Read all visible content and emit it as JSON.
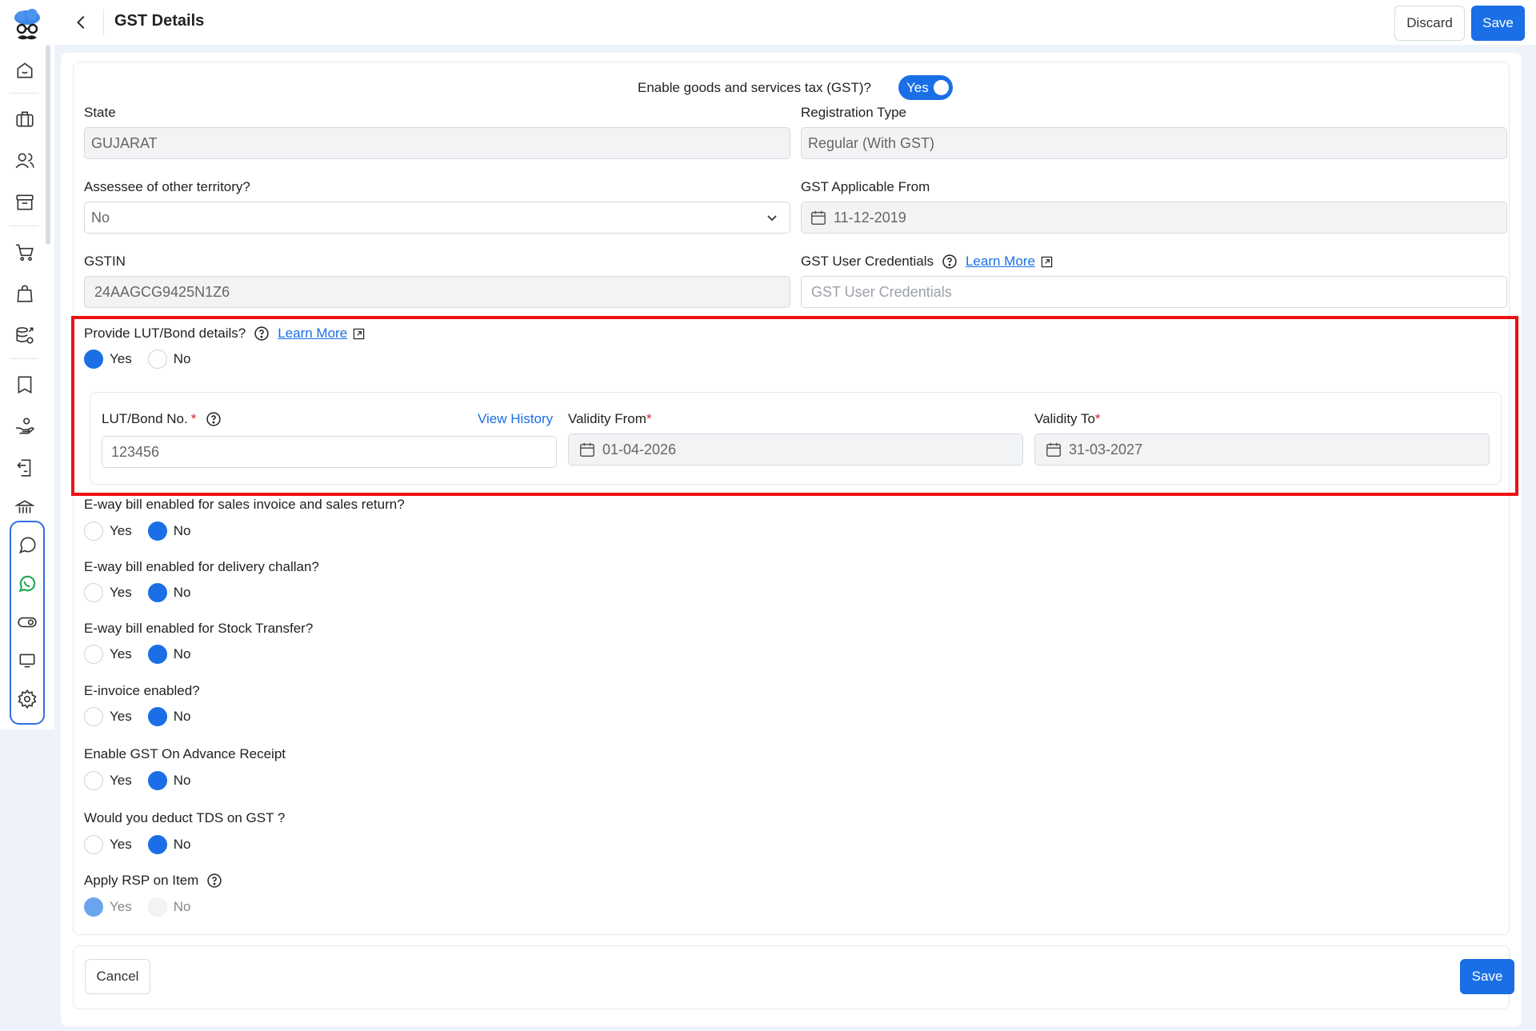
{
  "header": {
    "title": "GST Details",
    "discard_label": "Discard",
    "save_label": "Save"
  },
  "form": {
    "enable_gst": {
      "question": "Enable goods and services tax (GST)?",
      "toggle_label": "Yes"
    },
    "state": {
      "label": "State",
      "value": "GUJARAT"
    },
    "registration_type": {
      "label": "Registration Type",
      "value": "Regular (With GST)"
    },
    "assessee": {
      "label": "Assessee of other territory?",
      "value": "No"
    },
    "gst_applicable_from": {
      "label": "GST Applicable From",
      "value": "11-12-2019"
    },
    "gstin": {
      "label": "GSTIN",
      "value": "24AAGCG9425N1Z6"
    },
    "gst_user_credentials": {
      "label": "GST User Credentials",
      "learn_more": "Learn More",
      "placeholder": "GST User Credentials"
    },
    "lut": {
      "question": "Provide LUT/Bond details?",
      "learn_more": "Learn More",
      "yes": "Yes",
      "no": "No",
      "bond_no_label": "LUT/Bond No.",
      "required_mark": "*",
      "view_history": "View History",
      "bond_no_value": "123456",
      "validity_from_label": "Validity From",
      "validity_from_value": "01-04-2026",
      "validity_to_label": "Validity To",
      "validity_to_value": "31-03-2027"
    },
    "questions": [
      {
        "label": "E-way bill enabled for sales invoice and sales return?",
        "yes": "Yes",
        "no": "No"
      },
      {
        "label": "E-way bill enabled for delivery challan?",
        "yes": "Yes",
        "no": "No"
      },
      {
        "label": "E-way bill enabled for Stock Transfer?",
        "yes": "Yes",
        "no": "No"
      },
      {
        "label": "E-invoice enabled?",
        "yes": "Yes",
        "no": "No"
      },
      {
        "label": "Enable GST On Advance Receipt",
        "yes": "Yes",
        "no": "No"
      },
      {
        "label": "Would you deduct TDS on GST ?",
        "yes": "Yes",
        "no": "No"
      },
      {
        "label": "Apply RSP on Item",
        "yes": "Yes",
        "no": "No"
      }
    ]
  },
  "footer": {
    "cancel_label": "Cancel",
    "save_label": "Save"
  },
  "colors": {
    "primary": "#1a6fe6",
    "highlight": "#ee1111",
    "whatsapp": "#1fa855"
  },
  "sidebar_icons": [
    "home-icon",
    "briefcase-icon",
    "users-icon",
    "archive-icon",
    "cart-icon",
    "bag-icon",
    "database-export-icon",
    "book-icon",
    "hand-coins-icon",
    "receipt-icon",
    "bank-icon",
    "chat-icon",
    "whatsapp-icon",
    "toggle-icon",
    "monitor-icon",
    "settings-icon"
  ]
}
